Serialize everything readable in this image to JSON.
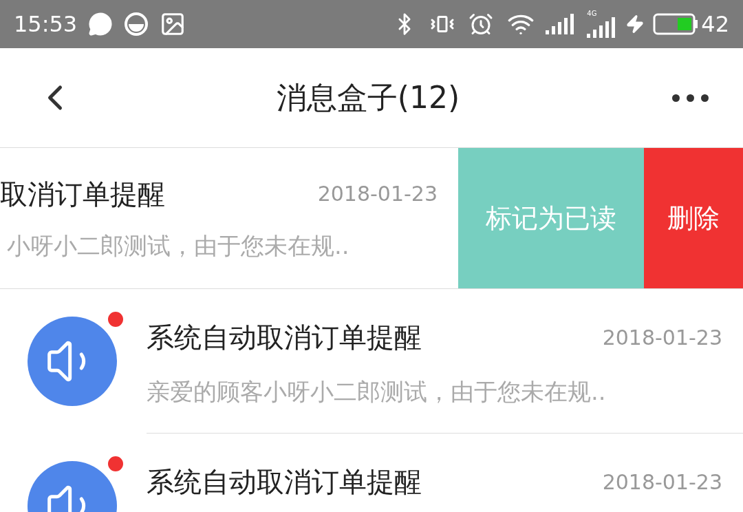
{
  "status_bar": {
    "time": "15:53",
    "battery_text": "42",
    "network": "4G"
  },
  "header": {
    "title": "消息盒子(12)"
  },
  "swiped_row": {
    "title": "取消订单提醒",
    "date": "2018-01-23",
    "preview": "小呀小二郎测试，由于您未在规..",
    "actions": [
      {
        "kind": "mark",
        "label": "标记为已读"
      },
      {
        "kind": "delete",
        "label": "删除"
      }
    ]
  },
  "messages": [
    {
      "title": "系统自动取消订单提醒",
      "date": "2018-01-23",
      "preview": "亲爱的顾客小呀小二郎测试，由于您未在规..",
      "unread": true
    },
    {
      "title": "系统自动取消订单提醒",
      "date": "2018-01-23",
      "unread": true
    }
  ]
}
